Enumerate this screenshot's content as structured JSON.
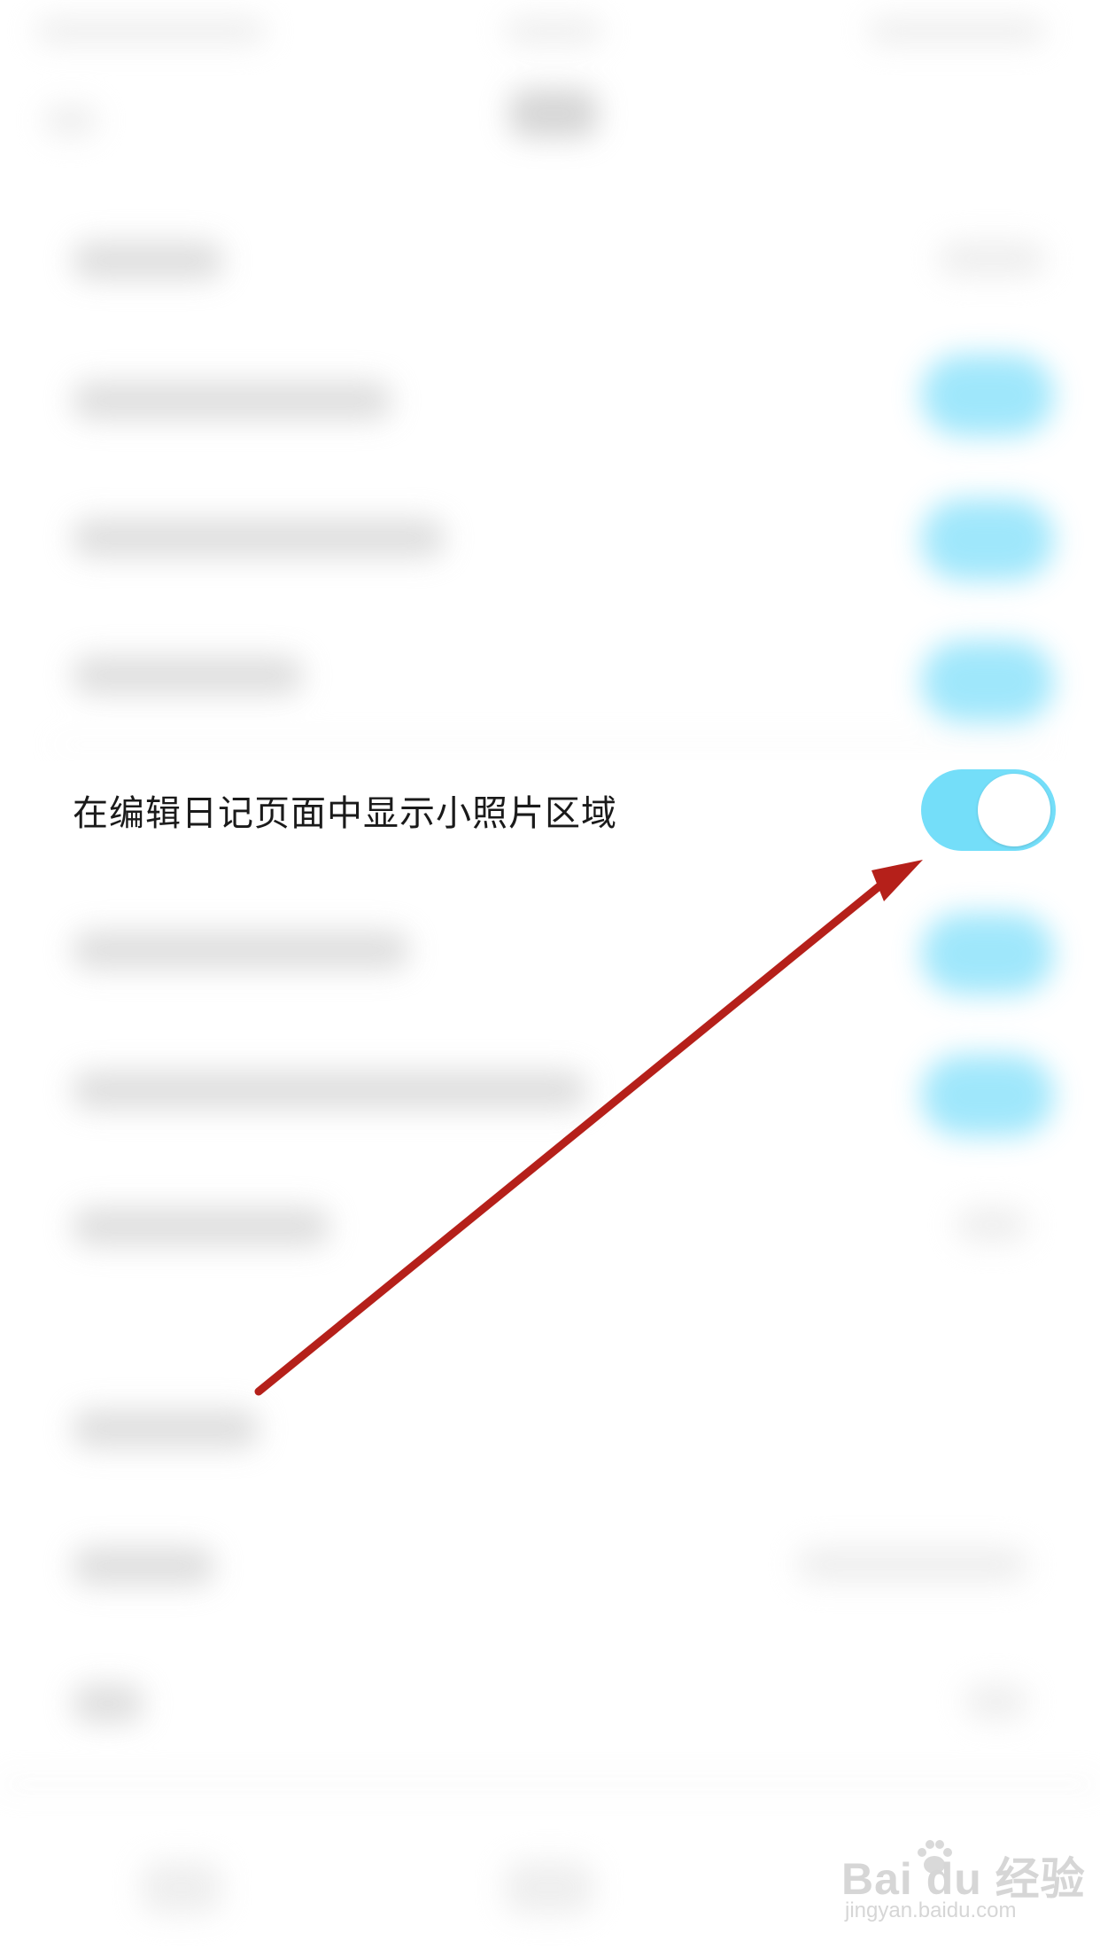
{
  "focused_setting": {
    "label": "在编辑日记页面中显示小照片区域",
    "toggle_state": "on"
  },
  "colors": {
    "toggle_on": "#74def9",
    "arrow": "#b5201a",
    "background": "#ffffff"
  },
  "watermark": {
    "brand": "Bai  du 经验",
    "url": "jingyan.baidu.com"
  }
}
